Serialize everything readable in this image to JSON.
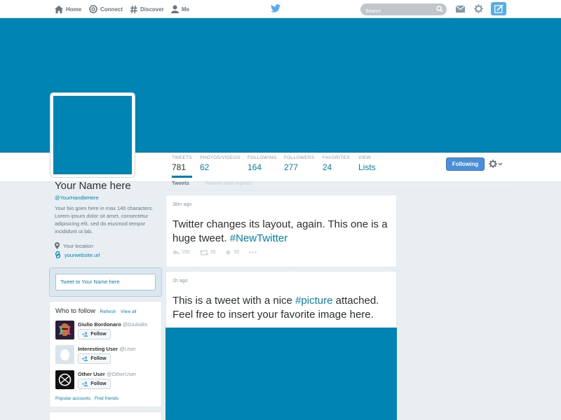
{
  "topbar": {
    "nav": [
      {
        "label": "Home",
        "icon": "home-icon"
      },
      {
        "label": "Connect",
        "icon": "at-icon"
      },
      {
        "label": "Discover",
        "icon": "hash-icon"
      },
      {
        "label": "Me",
        "icon": "person-icon"
      }
    ],
    "search_placeholder": "Search"
  },
  "profile": {
    "name": "Your Name here",
    "handle": "@YourHandleHere",
    "bio": "Your bio goes here in max 140 characters. Lorem ipsum dolor sit amet, consectetur adipisicing elit, sed do eiusmod tempor incididunt ut lab.",
    "location": "Your location",
    "website": "yourwebsite.url"
  },
  "stats": [
    {
      "label": "TWEETS",
      "value": "781"
    },
    {
      "label": "PHOTOS/VIDEOS",
      "value": "62"
    },
    {
      "label": "FOLLOWING",
      "value": "164"
    },
    {
      "label": "FOLLOWERS",
      "value": "277"
    },
    {
      "label": "FAVORITES",
      "value": "24"
    },
    {
      "label": "VIEW",
      "value": "Lists"
    }
  ],
  "following_button": "Following",
  "tabs": [
    "Tweets",
    "Tweets and replies"
  ],
  "tweetbox_placeholder": "Tweet to Your Name here",
  "who_to_follow": {
    "title": "Who to follow",
    "refresh": "Refresh",
    "view_all": "View all",
    "separator": "·",
    "users": [
      {
        "name": "Giulio Bordonaro",
        "handle": "@GiulioBx"
      },
      {
        "name": "Interesting User",
        "handle": "@User"
      },
      {
        "name": "Other User",
        "handle": "@OtherUser"
      }
    ],
    "follow_label": "Follow",
    "footer_popular": "Popular accounts",
    "footer_find": "Find friends"
  },
  "tweets": [
    {
      "time": "38m ago",
      "text": "Twitter changes its layout, again. This one is a huge tweet. ",
      "hashtag": "#NewTwitter",
      "text_after": "",
      "retweets": "150",
      "replies": "35",
      "favorites": "50"
    },
    {
      "time": "1h ago",
      "text": "This is a tweet with a nice ",
      "hashtag": "#picture",
      "text_after": " attached. Feel free to insert your favorite image here."
    }
  ],
  "colors": {
    "brand": "#0084b4",
    "twitter_blue": "#55acee",
    "background": "#e9eef2"
  }
}
